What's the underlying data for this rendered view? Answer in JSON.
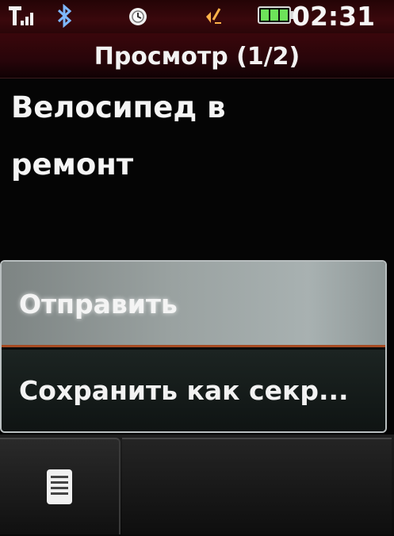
{
  "status_bar": {
    "time": "02:31",
    "icons": [
      "signal-icon",
      "bluetooth-icon",
      "alarm-icon",
      "volume-icon",
      "battery-icon"
    ],
    "battery_color": "#6de35a"
  },
  "header": {
    "title": "Просмотр (1/2)"
  },
  "message": {
    "lines": [
      "Велосипед в",
      "ремонт"
    ]
  },
  "menu": {
    "items": [
      {
        "label": "Отправить",
        "selected": true
      },
      {
        "label": "Сохранить как секр...",
        "selected": false
      }
    ]
  },
  "softkeys": {
    "left_icon": "menu-list-icon",
    "right_label": ""
  },
  "colors": {
    "header_bg": "#3a060b",
    "selection_bg": "#9aa2a1",
    "selection_underline": "#a64a22"
  }
}
